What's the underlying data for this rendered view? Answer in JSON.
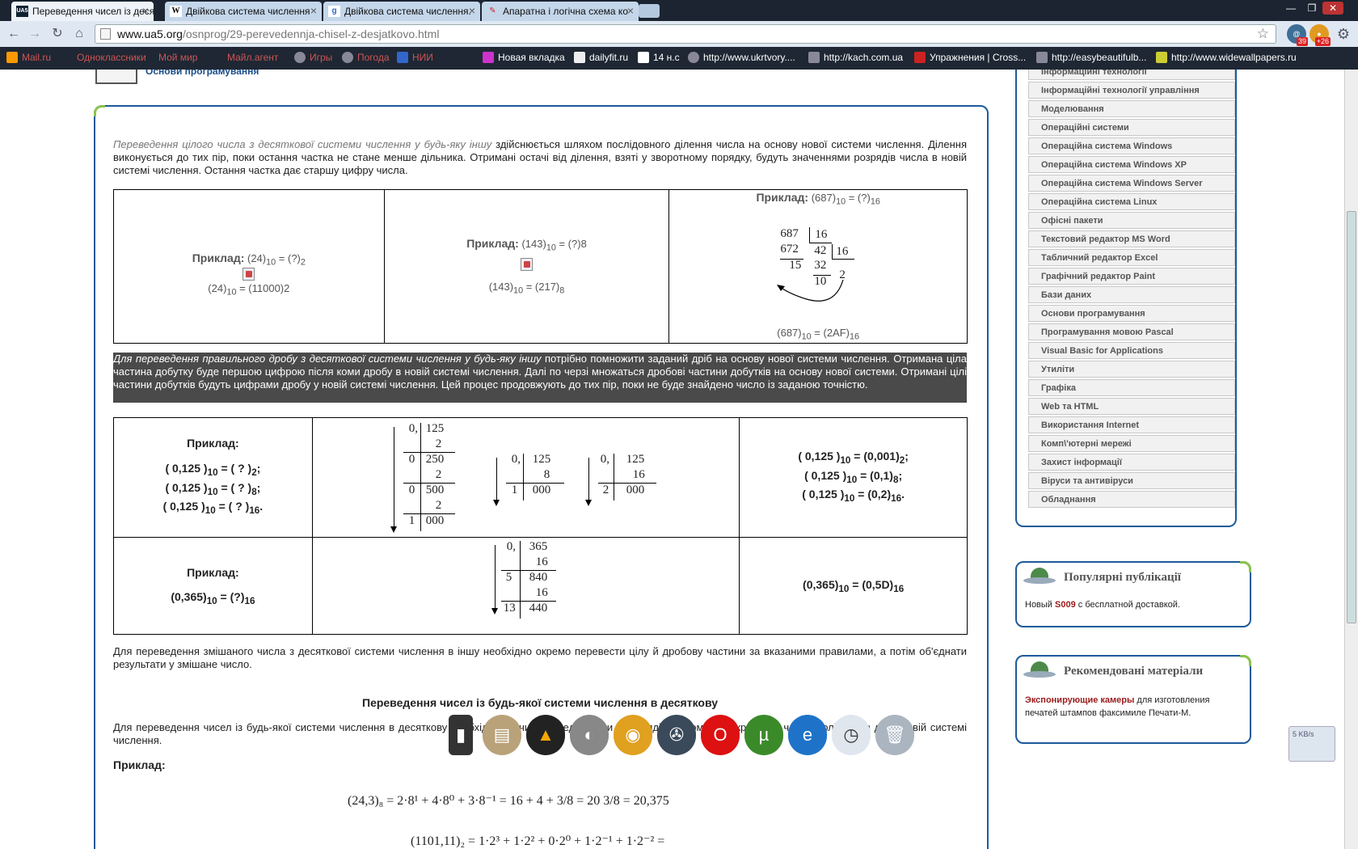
{
  "browser": {
    "tabs": [
      {
        "icon": "UA5",
        "title": "Переведення чисел із десяті"
      },
      {
        "icon": "W",
        "title": "Двійкова система числення"
      },
      {
        "icon": "g",
        "title": "Двійкова система числення."
      },
      {
        "icon": "✎",
        "title": "Апаратна і логічна схема ко"
      }
    ],
    "url_host": "www.ua5.org",
    "url_path": "/osnprog/29-perevedennja-chisel-z-desjatkovo.html",
    "ext_badges": [
      "39",
      "+26"
    ],
    "bookmarks": [
      "Mail.ru",
      "Одноклассники",
      "Мой мир",
      "Майл.агент",
      "Игры",
      "Погода",
      "НИИ",
      "Новая вкладка",
      "dailyfit.ru",
      "14 н.с",
      "http://www.ukrtvory....",
      "http://kach.com.ua",
      "Упражнения | Cross...",
      "http://easybeautifulb...",
      "http://www.widewallpapers.ru"
    ]
  },
  "header": {
    "link": "Основи програмування"
  },
  "article": {
    "p1_italic": "Переведення цілого числа з десяткової системи числення у будь-яку іншу",
    "p1_rest": " здійснюється шляхом послідовного ділення числа на основу нової системи числення. Ділення виконується до тих пір, поки остання частка не стане менше дільника. Отримані остачі від ділення, взяті у зворотному порядку, будуть значеннями розрядів числа в новій системі числення. Остання частка дає старшу цифру числа.",
    "ex1": {
      "label": "Приклад:",
      "q_pre": "(24)",
      "q_sub1": "10",
      "q_mid": " = (?)",
      "q_sub2": "2",
      "a_pre": "(24)",
      "a_sub": "10",
      "a_rest": " = (11000)2"
    },
    "ex2": {
      "label": "Приклад:",
      "q_pre": "(143)",
      "q_sub1": "10",
      "q_rest": " = (?)8",
      "a_pre": "(143)",
      "a_sub1": "10",
      "a_mid": " = (217)",
      "a_sub2": "8"
    },
    "ex3": {
      "label": "Приклад:",
      "q_pre": "(687)",
      "q_sub1": "10",
      "q_mid": " = (?)",
      "q_sub2": "16",
      "div": {
        "n1": "687",
        "d1": "16",
        "s1": "672",
        "n2": "42",
        "d2": "16",
        "r1": "15",
        "s2": "32",
        "r2": "10",
        "q": "2"
      },
      "a_pre": "(687)",
      "a_sub1": "10",
      "a_mid": " = (2AF)",
      "a_sub2": "16"
    },
    "p2_italic": "Для переведення правильного дробу з десяткової системи числення у будь-яку іншу",
    "p2_rest": " потрібно помножити заданий дріб на основу нової системи числення. Отримана ціла частина добутку буде першою цифрою після коми дробу в новій системі числення. Далі по черзі множаться дробові частини добутків на основу нової системи. Отримані цілі частини добутків будуть цифрами дробу у новій системі числення. Цей процес продовжують до тих пір, поки не буде знайдено число із заданою точністю.",
    "frac1": {
      "label": "Приклад:",
      "lines": [
        {
          "pre": "( 0,125 )",
          "sub1": "10",
          "mid": " = ( ? )",
          "sub2": "2",
          "end": ";"
        },
        {
          "pre": "( 0,125 )",
          "sub1": "10",
          "mid": " = ( ? )",
          "sub2": "8",
          "end": ";"
        },
        {
          "pre": "( 0,125 )",
          "sub1": "10",
          "mid": " = ( ? )",
          "sub2": "16",
          "end": "."
        }
      ],
      "col_a": [
        "0,",
        "125",
        "2",
        "0",
        "250",
        "2",
        "0",
        "500",
        "2",
        "1",
        "000"
      ],
      "col_b": [
        "0,",
        "125",
        "8",
        "1",
        "000"
      ],
      "col_c": [
        "0,",
        "125",
        "16",
        "2",
        "000"
      ],
      "results": [
        {
          "pre": "( 0,125 )",
          "sub1": "10",
          "mid": " = (0,001)",
          "sub2": "2",
          "end": ";"
        },
        {
          "pre": "( 0,125 )",
          "sub1": "10",
          "mid": " = (0,1)",
          "sub2": "8",
          "end": ";"
        },
        {
          "pre": "( 0,125 )",
          "sub1": "10",
          "mid": " = (0,2)",
          "sub2": "16",
          "end": "."
        }
      ]
    },
    "frac2": {
      "label": "Приклад:",
      "q_pre": "(0,365)",
      "q_sub1": "10",
      "q_mid": " = (?)",
      "q_sub2": "16",
      "col": [
        "0,",
        "365",
        "16",
        "5",
        "840",
        "16",
        "13",
        "440"
      ],
      "r_pre": "(0,365)",
      "r_sub1": "10",
      "r_mid": " = (0,5D)",
      "r_sub2": "16"
    },
    "p3": "Для переведення змішаного числа з десяткової системи числення в іншу необхідно окремо перевести цілу й дробову частини за вказаними правилами, а потім об'єднати результати у змішане число.",
    "section_title": "Переведення чисел із будь-якої системи числення в десяткову",
    "p4": "Для переведення чисел із будь-якої системи числення в десяткову необхідно це число представити у вигляді полінома і розкрити всі члени полінома в десятковій системі числення.",
    "ex_label": "Приклад:",
    "formula1": "(24,3)₈ = 2·8¹ + 4·8⁰ + 3·8⁻¹ = 16 + 4 + 3/8 = 20 3/8 = 20,375",
    "formula2": "(1101,11)₂ = 1·2³ + 1·2² + 0·2⁰ + 1·2⁻¹ + 1·2⁻² ="
  },
  "sidebar": {
    "menu": [
      "Інформаційні технології",
      "Інформаційні технології управління",
      "Моделювання",
      "Операційні системи",
      "Операційна система Windows",
      "Операційна система Windows XP",
      "Операційна система Windows Server",
      "Операційна система Linux",
      "Офісні пакети",
      "Текстовий редактор MS Word",
      "Табличний редактор Excel",
      "Графічний редактор Paint",
      "Бази даних",
      "Основи програмування",
      "Програмування мовою Pascal",
      "Visual Basic for Applications",
      "Утиліти",
      "Графіка",
      "Web та HTML",
      "Використання Internet",
      "Комп\\'ютерні мережі",
      "Захист інформації",
      "Віруси та антивіруси",
      "Обладнання"
    ],
    "popular": {
      "title": "Популярні публікації",
      "pre": "Новый ",
      "link": "S009",
      "post": " с бесплатной доставкой."
    },
    "recommended": {
      "title": "Рекомендовані матеріали",
      "link": "Экспонирующие камеры",
      "post": " для изготовления печатей штампов факсимиле Печати-М."
    }
  },
  "dock_icons": [
    "phone-icon",
    "folder-icon",
    "aimp-icon",
    "speaker-icon",
    "chrome-icon",
    "film-icon",
    "opera-icon",
    "utorrent-icon",
    "ie-icon",
    "clock-icon",
    "trash-icon"
  ],
  "net_meter": "5 KB/s"
}
